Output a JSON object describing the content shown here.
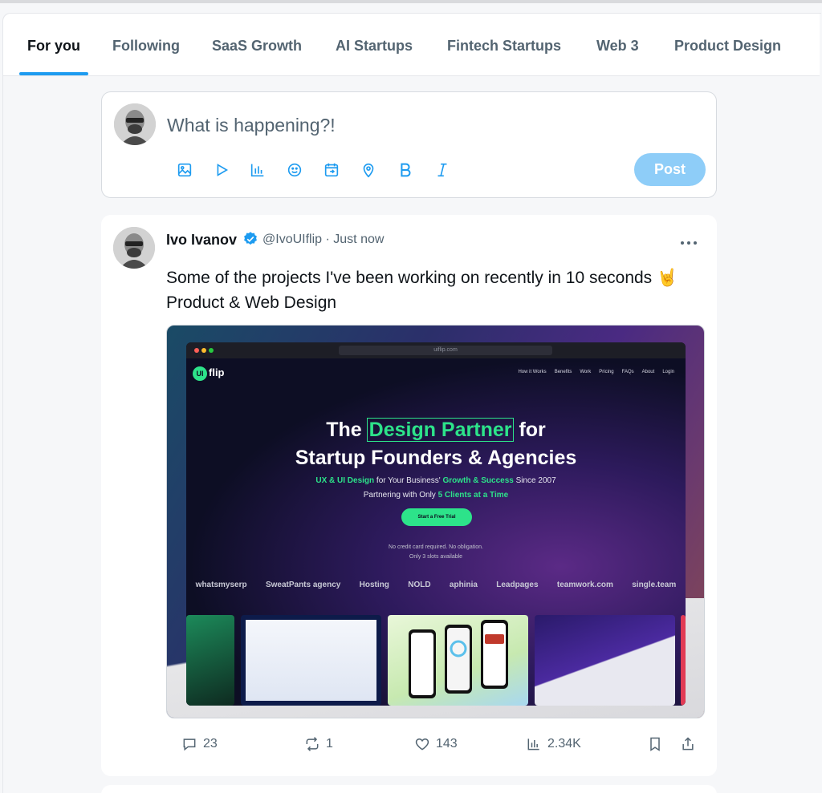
{
  "tabs": [
    {
      "label": "For you",
      "active": true
    },
    {
      "label": "Following"
    },
    {
      "label": "SaaS Growth"
    },
    {
      "label": "AI Startups"
    },
    {
      "label": "Fintech Startups"
    },
    {
      "label": "Web 3"
    },
    {
      "label": "Product Design"
    }
  ],
  "composer": {
    "placeholder": "What is happening?!",
    "tools": [
      "image-icon",
      "video-icon",
      "poll-icon",
      "emoji-icon",
      "schedule-icon",
      "location-icon",
      "bold-icon",
      "italic-icon"
    ],
    "post_label": "Post"
  },
  "post": {
    "author": "Ivo Ivanov",
    "handle": "@IvoUIflip",
    "separator": "·",
    "time": "Just now",
    "text_line1": "Some of the projects I've been working on recently in 10 seconds 🤘",
    "text_line2": "Product & Web Design",
    "media": {
      "url": "uiflip.com",
      "logo_badge": "UI",
      "logo_text": "flip",
      "nav": [
        "How it Works",
        "Benefits",
        "Work",
        "Pricing",
        "FAQs",
        "About",
        "Login"
      ],
      "title_pre": "The",
      "title_accent": "Design Partner",
      "title_post": "for",
      "title_line2": "Startup Founders & Agencies",
      "sub1_a": "UX & UI Design",
      "sub1_b": " for Your Business' ",
      "sub1_c": "Growth & Success",
      "sub1_d": " Since 2007",
      "sub2_a": "Partnering with Only ",
      "sub2_b": "5 Clients at a Time",
      "cta": "Start a Free Trial",
      "note1": "No credit card required. No obligation.",
      "note2": "Only 3 slots available",
      "logos": [
        "whatsmyserp",
        "SweatPants agency",
        "Hosting",
        "NOLD",
        "aphinia",
        "Leadpages",
        "teamwork.com",
        "single.team"
      ]
    },
    "stats": {
      "replies": "23",
      "reposts": "1",
      "likes": "143",
      "views": "2.34K"
    }
  },
  "colors": {
    "accent": "#1d9bf0",
    "post_button": "#8ecdf8",
    "site_green": "#2de38a"
  }
}
